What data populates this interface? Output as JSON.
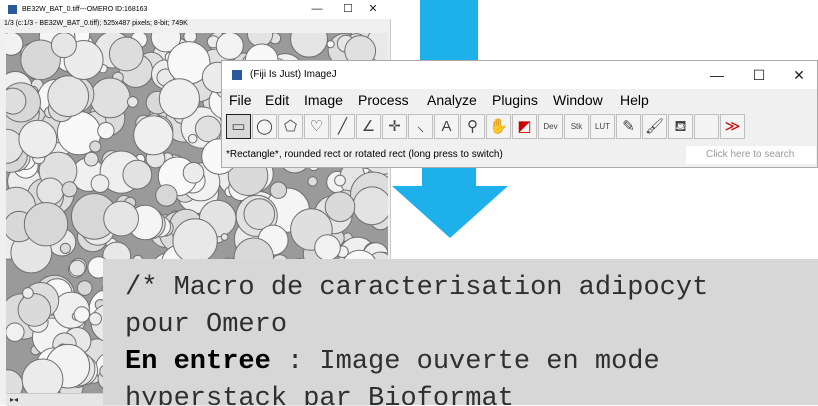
{
  "image_window": {
    "title": "BE32W_BAT_0.tiff---OMERO ID:168163",
    "subtitle": "1/3 (c:1/3 - BE32W_BAT_0.tiff); 525x487 pixels; 8-bit; 749K",
    "controls": {
      "minimize": "—",
      "maximize": "☐",
      "close": "✕"
    }
  },
  "imagej": {
    "title": "(Fiji Is Just) ImageJ",
    "controls": {
      "minimize": "—",
      "maximize": "☐",
      "close": "✕"
    },
    "menus": [
      "File",
      "Edit",
      "Image",
      "Process",
      "Analyze",
      "Plugins",
      "Window",
      "Help"
    ],
    "tools": [
      {
        "name": "rectangle-tool",
        "glyph": "▭",
        "selected": true
      },
      {
        "name": "oval-tool",
        "glyph": "◯"
      },
      {
        "name": "polygon-tool",
        "glyph": "⬠"
      },
      {
        "name": "freehand-tool",
        "glyph": "♡"
      },
      {
        "name": "line-tool",
        "glyph": "╱"
      },
      {
        "name": "angle-tool",
        "glyph": "∠"
      },
      {
        "name": "point-tool",
        "glyph": "✛"
      },
      {
        "name": "wand-tool",
        "glyph": "⸜"
      },
      {
        "name": "text-tool",
        "glyph": "A"
      },
      {
        "name": "zoom-tool",
        "glyph": "⚲"
      },
      {
        "name": "hand-tool",
        "glyph": "✋"
      },
      {
        "name": "color-picker-tool",
        "glyph": "◩"
      },
      {
        "name": "dev-tool",
        "glyph": "Dev"
      },
      {
        "name": "stk-tool",
        "glyph": "Stk"
      },
      {
        "name": "lut-tool",
        "glyph": "LUT"
      },
      {
        "name": "pencil-tool",
        "glyph": "✎"
      },
      {
        "name": "brush-tool",
        "glyph": "🖌"
      },
      {
        "name": "flood-fill-tool",
        "glyph": "⛾"
      },
      {
        "name": "blank-tool",
        "glyph": ""
      },
      {
        "name": "more-tools",
        "glyph": "≫"
      }
    ],
    "status": "*Rectangle*, rounded rect or rotated rect (long press to switch)",
    "search_placeholder": "Click here to search"
  },
  "code": {
    "line1": "/* Macro de caracterisation adipocyt",
    "line2": "pour Omero",
    "line3_bold": "En entree",
    "line3_rest": " : Image ouverte en mode",
    "line4": "hyperstack par Bioformat"
  },
  "colors": {
    "arrow": "#1eb0eb",
    "code_bg": "#d7d7d7"
  }
}
